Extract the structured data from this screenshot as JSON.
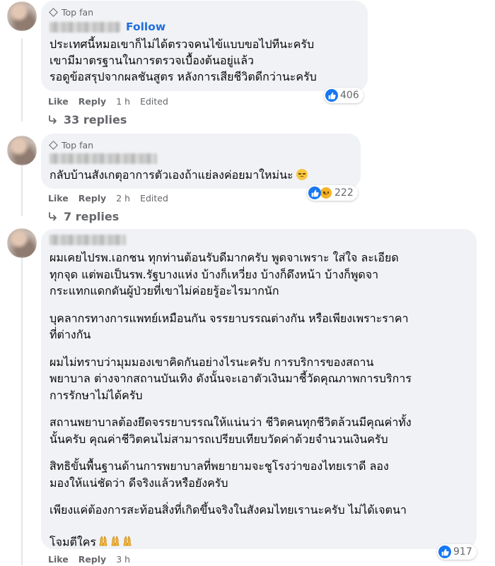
{
  "comments": [
    {
      "badge": "Top fan",
      "follow_label": "Follow",
      "paragraphs": [
        "ประเทศนี้หมอเขาก็ไม่ได้ตรวจคนไข้แบบขอไปทีนะครับ\nเขามีมาตรฐานในการตรวจเบื้องต้นอยู่แล้ว\nรอดูข้อสรุปจากผลชันสูตร หลังการเสียชีวิตดีกว่านะครับ"
      ],
      "reaction_count": "406",
      "actions": {
        "like": "Like",
        "reply": "Reply",
        "time": "1 h",
        "edited": "Edited"
      },
      "replies_label": "33 replies"
    },
    {
      "badge": "Top fan",
      "paragraphs": [
        "กลับบ้านสังเกตุอาการตัวเองถ้าแย่ลงค่อยมาใหม่นะ"
      ],
      "reaction_count": "222",
      "actions": {
        "like": "Like",
        "reply": "Reply",
        "time": "2 h",
        "edited": "Edited"
      },
      "replies_label": "7 replies"
    },
    {
      "paragraphs": [
        "ผมเคยไปรพ.เอกชน ทุกท่านต้อนรับดีมากครับ พูดจาเพราะ ใส่ใจ ละเอียด\nทุกจุด แต่พอเป็นรพ.รัฐบางแห่ง บ้างก็เหวี่ยง บ้างก็ดึงหน้า บ้างก็พูดจา\nกระแทกแดกดันผู้ป่วยที่เขาไม่ค่อยรู้อะไรมากนัก",
        "บุคลากรทางการแพทย์เหมือนกัน จรรยาบรรณต่างกัน หรือเพียงเพราะราคา\nที่ต่างกัน",
        "ผมไม่ทราบว่ามุมมองเขาคิดกันอย่างไรนะครับ การบริการของสถาน\nพยาบาล ต่างจากสถานบันเทิง ดังนั้นจะเอาตัวเงินมาชี้วัดคุณภาพการบริการ\nการรักษาไม่ได้ครับ",
        "สถานพยาบาลต้องยึดจรรยาบรรณให้แน่นว่า ชีวิตคนทุกชีวิตล้วนมีคุณค่าทั้ง\nนั้นครับ คุณค่าชีวิตคนไม่สามารถเปรียบเทียบวัดค่าด้วยจำนวนเงินครับ",
        "สิทธิขั้นพื้นฐานด้านการพยาบาลที่พยายามจะชูโรงว่าของไทยเราดี ลอง\nมองให้แน่ชัดว่า ดีจริงแล้วหรือยังครับ",
        "เพียงแค่ต้องการสะท้อนสิ่งที่เกิดขึ้นจริงในสังคมไทยเรานะครับ ไม่ได้เจตนา\nโจมตีใคร"
      ],
      "reaction_count": "917",
      "actions": {
        "like": "Like",
        "reply": "Reply",
        "time": "3 h"
      }
    }
  ],
  "icons": {
    "like": "like-reaction-icon",
    "sad": "sad-reaction-icon",
    "reply_arrow": "reply-arrow-icon",
    "badge": "diamond-badge-icon"
  },
  "colors": {
    "bubble": "#f0f2f5",
    "like_blue": "#1877f2",
    "follow_blue": "#216fdb",
    "meta_gray": "#65676b"
  }
}
